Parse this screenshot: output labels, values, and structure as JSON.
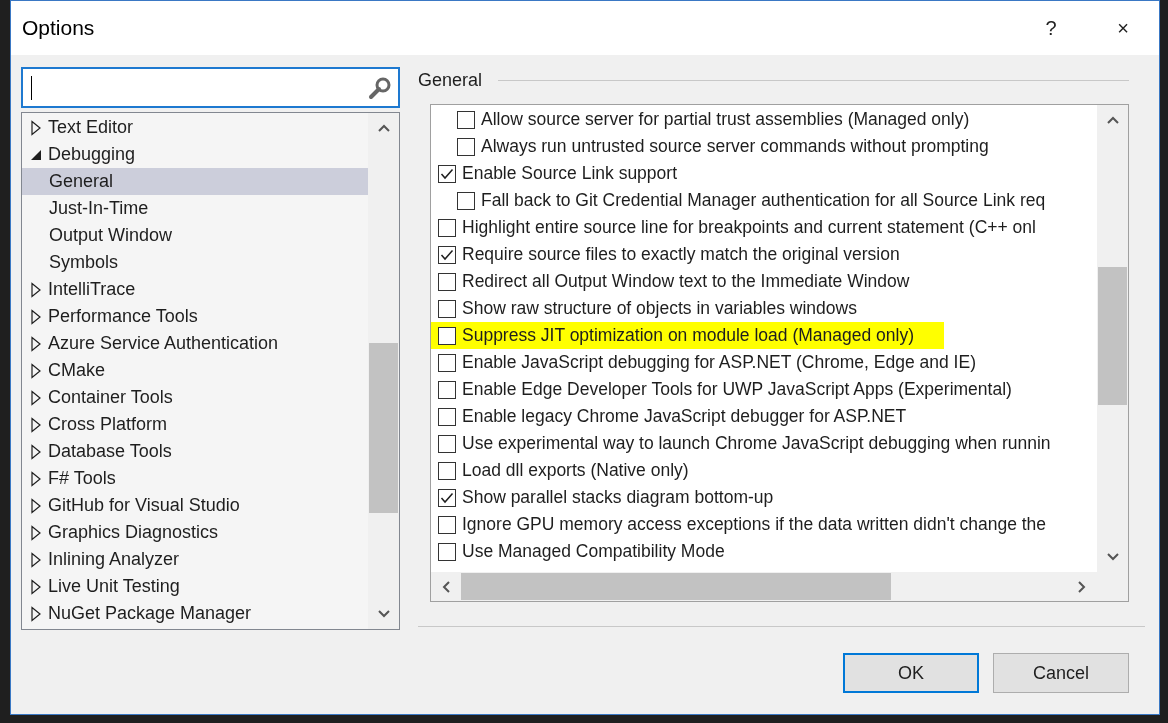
{
  "window": {
    "title": "Options",
    "help": "?",
    "close": "×"
  },
  "search": {
    "focused": true
  },
  "tree": [
    {
      "label": "Text Editor",
      "expanded": false,
      "selected": false
    },
    {
      "label": "Debugging",
      "expanded": true,
      "selected": false,
      "children": [
        {
          "label": "General",
          "selected": true
        },
        {
          "label": "Just-In-Time",
          "selected": false
        },
        {
          "label": "Output Window",
          "selected": false
        },
        {
          "label": "Symbols",
          "selected": false
        }
      ]
    },
    {
      "label": "IntelliTrace",
      "expanded": false,
      "selected": false
    },
    {
      "label": "Performance Tools",
      "expanded": false,
      "selected": false
    },
    {
      "label": "Azure Service Authentication",
      "expanded": false,
      "selected": false
    },
    {
      "label": "CMake",
      "expanded": false,
      "selected": false
    },
    {
      "label": "Container Tools",
      "expanded": false,
      "selected": false
    },
    {
      "label": "Cross Platform",
      "expanded": false,
      "selected": false
    },
    {
      "label": "Database Tools",
      "expanded": false,
      "selected": false
    },
    {
      "label": "F# Tools",
      "expanded": false,
      "selected": false
    },
    {
      "label": "GitHub for Visual Studio",
      "expanded": false,
      "selected": false
    },
    {
      "label": "Graphics Diagnostics",
      "expanded": false,
      "selected": false
    },
    {
      "label": "Inlining Analyzer",
      "expanded": false,
      "selected": false
    },
    {
      "label": "Live Unit Testing",
      "expanded": false,
      "selected": false
    },
    {
      "label": "NuGet Package Manager",
      "expanded": false,
      "selected": false
    }
  ],
  "section": {
    "title": "General"
  },
  "options": [
    {
      "children": [
        {
          "label": "Allow source server for partial trust assemblies (Managed only)",
          "checked": false,
          "highlighted": false
        },
        {
          "label": "Always run untrusted source server commands without prompting",
          "checked": false,
          "highlighted": false
        }
      ]
    },
    {
      "label": "Enable Source Link support",
      "checked": true,
      "highlighted": false,
      "children": [
        {
          "label": "Fall back to Git Credential Manager authentication for all Source Link req",
          "checked": false,
          "highlighted": false
        }
      ]
    },
    {
      "label": "Highlight entire source line for breakpoints and current statement (C++ onl",
      "checked": false,
      "highlighted": false
    },
    {
      "label": "Require source files to exactly match the original version",
      "checked": true,
      "highlighted": false
    },
    {
      "label": "Redirect all Output Window text to the Immediate Window",
      "checked": false,
      "highlighted": false
    },
    {
      "label": "Show raw structure of objects in variables windows",
      "checked": false,
      "highlighted": false
    },
    {
      "label": "Suppress JIT optimization on module load (Managed only)",
      "checked": false,
      "highlighted": true
    },
    {
      "label": "Enable JavaScript debugging for ASP.NET (Chrome, Edge and IE)",
      "checked": false,
      "highlighted": false
    },
    {
      "label": "Enable Edge Developer Tools for UWP JavaScript Apps (Experimental)",
      "checked": false,
      "highlighted": false
    },
    {
      "label": "Enable legacy Chrome JavaScript debugger for ASP.NET",
      "checked": false,
      "highlighted": false
    },
    {
      "label": "Use experimental way to launch Chrome JavaScript debugging when runnin",
      "checked": false,
      "highlighted": false
    },
    {
      "label": "Load dll exports (Native only)",
      "checked": false,
      "highlighted": false
    },
    {
      "label": "Show parallel stacks diagram bottom-up",
      "checked": true,
      "highlighted": false
    },
    {
      "label": "Ignore GPU memory access exceptions if the data written didn't change the",
      "checked": false,
      "highlighted": false
    },
    {
      "label": "Use Managed Compatibility Mode",
      "checked": false,
      "highlighted": false
    }
  ],
  "buttons": [
    {
      "label": "OK",
      "default": true
    },
    {
      "label": "Cancel",
      "default": false
    }
  ]
}
